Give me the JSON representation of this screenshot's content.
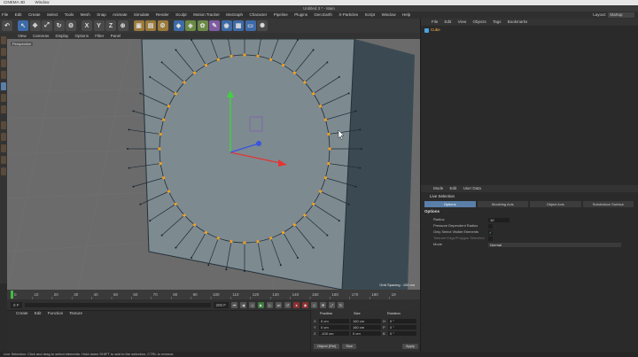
{
  "mac_menu": [
    "CINEMA 4D",
    "Window"
  ],
  "window_title": "Untitled 3 * - Main",
  "menu": [
    "File",
    "Edit",
    "Create",
    "Select",
    "Tools",
    "Mesh",
    "Snap",
    "Animate",
    "Simulate",
    "Render",
    "Sculpt",
    "Motion Tracker",
    "MoGraph",
    "Character",
    "Pipeline",
    "Plugins",
    "Gen.Earth",
    "X-Particles",
    "Script",
    "Window",
    "Help"
  ],
  "layout": {
    "label": "Layout:",
    "value": "Startup"
  },
  "toolbar": {
    "x_label": "X",
    "y_label": "Y",
    "z_label": "Z"
  },
  "view_menu": [
    "View",
    "Cameras",
    "Display",
    "Options",
    "Filter",
    "Panel"
  ],
  "viewport": {
    "camera_label": "Perspective",
    "grid_spacing": "Grid Spacing : 100 cm"
  },
  "timeline": {
    "ticks": [
      "0",
      "10",
      "20",
      "30",
      "40",
      "50",
      "60",
      "70",
      "80",
      "90",
      "100",
      "110",
      "120",
      "130",
      "140",
      "150",
      "160",
      "170",
      "180",
      "19"
    ]
  },
  "frame_controls": {
    "start": "0 F",
    "end": "200 F"
  },
  "material_menu": [
    "Create",
    "Edit",
    "Function",
    "Texture"
  ],
  "coords": {
    "position_label": "Position",
    "size_label": "Size",
    "rotation_label": "Rotation",
    "rows": [
      {
        "axis": "X",
        "pos": "0 cm",
        "size": "160 cm",
        "rot_axis": "H",
        "rot": "0 °"
      },
      {
        "axis": "Y",
        "pos": "0 cm",
        "size": "160 cm",
        "rot_axis": "P",
        "rot": "0 °"
      },
      {
        "axis": "Z",
        "pos": "-100 cm",
        "size": "0 cm",
        "rot_axis": "B",
        "rot": "0 °"
      }
    ],
    "mode_value": "Object (Rel)",
    "size_mode": "Size",
    "apply_label": "Apply"
  },
  "object_menu": [
    "File",
    "Edit",
    "View",
    "Objects",
    "Tags",
    "Bookmarks"
  ],
  "object_name": "Cube",
  "attr_menu": [
    "Mode",
    "Edit",
    "User Data"
  ],
  "attr_title": "Live Selection",
  "attr_tabs": [
    "Options",
    "Modeling Axis",
    "Object Axis",
    "Subdivision Surface"
  ],
  "attr_section": "Options",
  "attr_rows": {
    "radius_label": "Radius",
    "radius_value": "10",
    "pressure_label": "Pressure Dependent Radius",
    "visible_label": "Only Select Visible Elements",
    "visible_check": "✓",
    "tolerant_label": "Tolerant Edge/Polygon Selection",
    "mode_label": "Mode",
    "mode_value": "Normal"
  },
  "status": "Live Selection: Click and drag to select elements. Hold down SHIFT to add to the selection, CTRL to remove."
}
